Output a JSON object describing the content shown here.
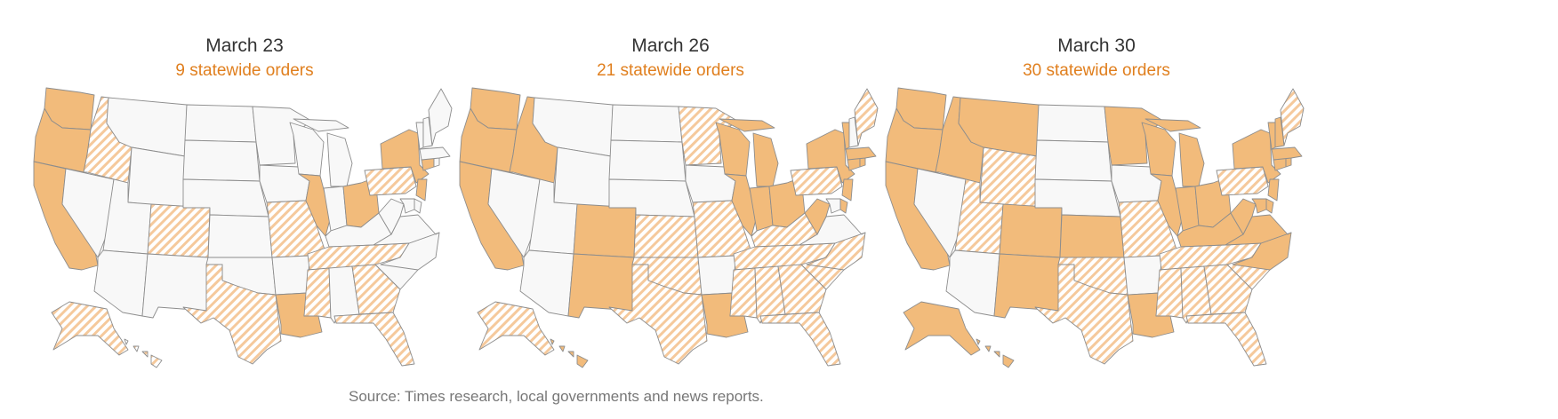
{
  "colors": {
    "order_fill": "#f2bb7b",
    "partial_hatch": "#f5c99c",
    "none_fill": "#f8f8f8",
    "state_stroke": "#8d8d8d",
    "subtitle_color": "#e07f1e"
  },
  "legend_encoding": {
    "order": "solid orange",
    "partial": "orange diagonal hatch",
    "none": "light gray"
  },
  "maps": [
    {
      "date": "March 23",
      "subtitle": "9 statewide orders",
      "states": {
        "WA": "order",
        "OR": "order",
        "CA": "order",
        "NV": "none",
        "ID": "partial",
        "MT": "none",
        "WY": "none",
        "UT": "none",
        "AZ": "none",
        "CO": "partial",
        "NM": "none",
        "ND": "none",
        "SD": "none",
        "NE": "none",
        "KS": "none",
        "OK": "none",
        "TX": "partial",
        "MN": "none",
        "IA": "none",
        "MO": "partial",
        "AR": "none",
        "LA": "order",
        "WI": "none",
        "IL": "order",
        "MI": "none",
        "IN": "none",
        "OH": "order",
        "KY": "none",
        "TN": "partial",
        "MS": "partial",
        "AL": "none",
        "GA": "partial",
        "FL": "partial",
        "SC": "none",
        "NC": "none",
        "VA": "none",
        "WV": "none",
        "PA": "partial",
        "NY": "order",
        "NJ": "order",
        "DE": "none",
        "MD": "none",
        "CT": "order",
        "RI": "none",
        "MA": "none",
        "VT": "none",
        "NH": "none",
        "ME": "none",
        "AK": "partial",
        "HI": "partial"
      }
    },
    {
      "date": "March 26",
      "subtitle": "21 statewide orders",
      "states": {
        "WA": "order",
        "OR": "order",
        "CA": "order",
        "NV": "none",
        "ID": "order",
        "MT": "none",
        "WY": "none",
        "UT": "none",
        "AZ": "none",
        "CO": "order",
        "NM": "order",
        "ND": "none",
        "SD": "none",
        "NE": "none",
        "KS": "partial",
        "OK": "partial",
        "TX": "partial",
        "MN": "partial",
        "IA": "none",
        "MO": "partial",
        "AR": "none",
        "LA": "order",
        "WI": "order",
        "IL": "order",
        "MI": "order",
        "IN": "order",
        "OH": "order",
        "KY": "partial",
        "TN": "partial",
        "MS": "partial",
        "AL": "partial",
        "GA": "partial",
        "FL": "partial",
        "SC": "partial",
        "NC": "partial",
        "VA": "none",
        "WV": "order",
        "PA": "partial",
        "NY": "order",
        "NJ": "order",
        "DE": "order",
        "MD": "none",
        "CT": "order",
        "RI": "order",
        "MA": "order",
        "VT": "order",
        "NH": "none",
        "ME": "partial",
        "AK": "partial",
        "HI": "order"
      }
    },
    {
      "date": "March 30",
      "subtitle": "30 statewide orders",
      "states": {
        "WA": "order",
        "OR": "order",
        "CA": "order",
        "NV": "none",
        "ID": "order",
        "MT": "order",
        "WY": "partial",
        "UT": "partial",
        "AZ": "none",
        "CO": "order",
        "NM": "order",
        "ND": "none",
        "SD": "none",
        "NE": "none",
        "KS": "order",
        "OK": "partial",
        "TX": "partial",
        "MN": "order",
        "IA": "none",
        "MO": "partial",
        "AR": "none",
        "LA": "order",
        "WI": "order",
        "IL": "order",
        "MI": "order",
        "IN": "order",
        "OH": "order",
        "KY": "order",
        "TN": "partial",
        "MS": "partial",
        "AL": "partial",
        "GA": "partial",
        "FL": "partial",
        "SC": "partial",
        "NC": "order",
        "VA": "order",
        "WV": "order",
        "PA": "partial",
        "NY": "order",
        "NJ": "order",
        "DE": "order",
        "MD": "order",
        "CT": "order",
        "RI": "order",
        "MA": "order",
        "VT": "order",
        "NH": "order",
        "ME": "partial",
        "AK": "order",
        "HI": "order"
      }
    }
  ],
  "source": "Source: Times research, local governments and news reports."
}
